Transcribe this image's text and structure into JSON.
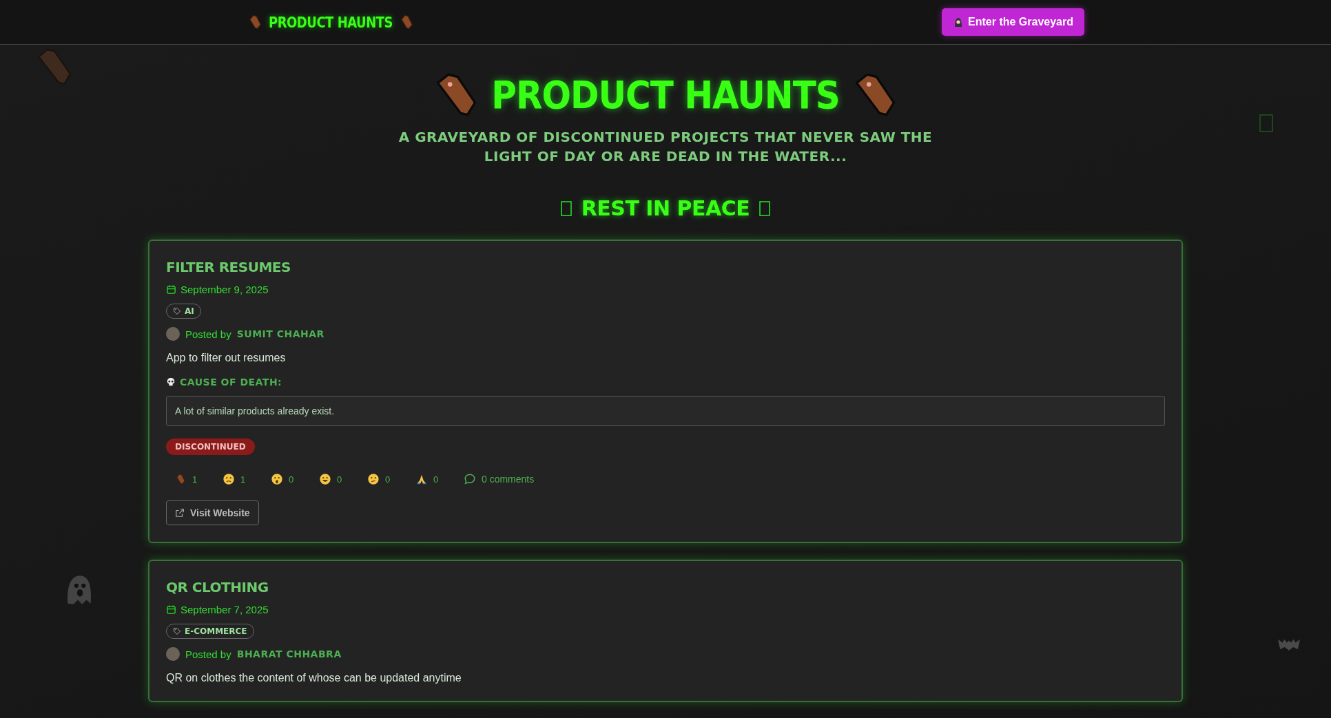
{
  "nav": {
    "logo": "PRODUCT HAUNTS",
    "cta": "Enter the Graveyard"
  },
  "hero": {
    "title": "PRODUCT HAUNTS",
    "subtitle": "A GRAVEYARD OF DISCONTINUED PROJECTS THAT NEVER SAW THE LIGHT OF DAY OR ARE DEAD IN THE WATER...",
    "section": "REST IN PEACE"
  },
  "posts": [
    {
      "title": "FILTER RESUMES",
      "date": "September 9, 2025",
      "tag": "AI",
      "posted_by": "Posted by",
      "author": "SUMIT CHAHAR",
      "description": "App to filter out resumes",
      "cause_label": "CAUSE OF DEATH:",
      "cause": "A lot of similar products already exist.",
      "status": "DISCONTINUED",
      "reactions": [
        {
          "kind": "coffin",
          "count": "1"
        },
        {
          "kind": "sad",
          "count": "1"
        },
        {
          "kind": "scream",
          "count": "0"
        },
        {
          "kind": "laugh",
          "count": "0"
        },
        {
          "kind": "confused",
          "count": "0"
        },
        {
          "kind": "pray",
          "count": "0"
        }
      ],
      "comments": "0 comments",
      "link": "Visit Website"
    },
    {
      "title": "QR CLOTHING",
      "date": "September 7, 2025",
      "tag": "E-COMMERCE",
      "posted_by": "Posted by",
      "author": "BHARAT CHHABRA",
      "description": "QR on clothes the content of whose can be updated anytime"
    }
  ]
}
